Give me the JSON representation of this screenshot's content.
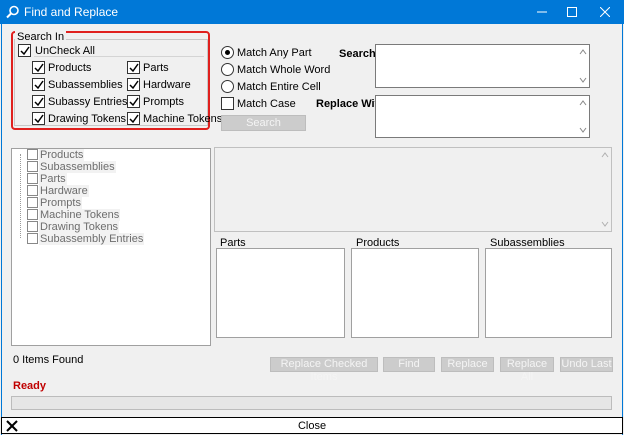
{
  "window": {
    "title": "Find and Replace"
  },
  "search_in": {
    "legend": "Search In",
    "uncheck_all": "UnCheck All",
    "options": [
      {
        "label": "Products",
        "checked": true
      },
      {
        "label": "Parts",
        "checked": true
      },
      {
        "label": "Subassemblies",
        "checked": true
      },
      {
        "label": "Hardware",
        "checked": true
      },
      {
        "label": "Subassy Entries",
        "checked": true
      },
      {
        "label": "Prompts",
        "checked": true
      },
      {
        "label": "Drawing Tokens",
        "checked": true
      },
      {
        "label": "Machine Tokens",
        "checked": true
      }
    ]
  },
  "match": {
    "options": [
      "Match Any Part",
      "Match Whole Word",
      "Match Entire Cell"
    ],
    "selected": "Match Any Part",
    "case_label": "Match Case",
    "search_button": "Search"
  },
  "fields": {
    "search_label": "Search:",
    "search_value": "",
    "replace_label": "Replace With:",
    "replace_value": ""
  },
  "tree": {
    "items": [
      "Products",
      "Subassemblies",
      "Parts",
      "Hardware",
      "Prompts",
      "Machine Tokens",
      "Drawing Tokens",
      "Subassembly Entries"
    ]
  },
  "panels": {
    "parts": "Parts",
    "products": "Products",
    "subassemblies": "Subassemblies"
  },
  "results": {
    "count_text": "0 Items Found"
  },
  "actions": {
    "replace_checked": "Replace Checked Items",
    "find": "Find",
    "replace": "Replace",
    "replace_all": "Replace All",
    "undo_last": "Undo Last"
  },
  "status": {
    "text": "Ready"
  },
  "footer": {
    "close": "Close"
  }
}
